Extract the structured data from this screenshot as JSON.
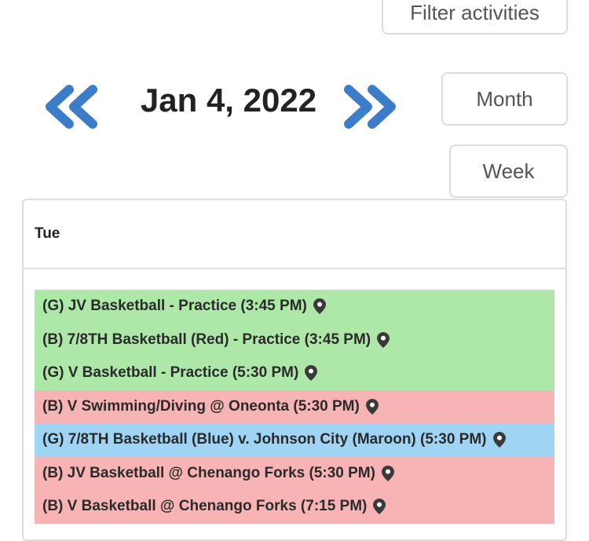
{
  "toolbar": {
    "filter_label": "Filter activities",
    "month_label": "Month",
    "week_label": "Week"
  },
  "nav": {
    "date": "Jan 4, 2022",
    "prev_icon": "double-chevron-left-icon",
    "next_icon": "double-chevron-right-icon"
  },
  "calendar": {
    "day_label": "Tue",
    "events": [
      {
        "label": "(G) JV Basketball - Practice (3:45 PM)",
        "color": "#aee8a8",
        "icon": "map-pin-icon"
      },
      {
        "label": "(B) 7/8TH Basketball (Red) - Practice (3:45 PM)",
        "color": "#aee8a8",
        "icon": "map-pin-icon"
      },
      {
        "label": "(G) V Basketball - Practice (5:30 PM)",
        "color": "#aee8a8",
        "icon": "map-pin-icon"
      },
      {
        "label": "(B) V Swimming/Diving @ Oneonta (5:30 PM)",
        "color": "#f8b4b4",
        "icon": "map-pin-icon"
      },
      {
        "label": "(G) 7/8TH Basketball (Blue) v. Johnson City (Maroon) (5:30 PM)",
        "color": "#9fd4f5",
        "icon": "map-pin-icon"
      },
      {
        "label": "(B) JV Basketball @ Chenango Forks (5:30 PM)",
        "color": "#f8b4b4",
        "icon": "map-pin-icon"
      },
      {
        "label": "(B) V Basketball @ Chenango Forks (7:15 PM)",
        "color": "#f8b4b4",
        "icon": "map-pin-icon"
      }
    ]
  },
  "colors": {
    "accent_blue": "#3d7cc9"
  }
}
